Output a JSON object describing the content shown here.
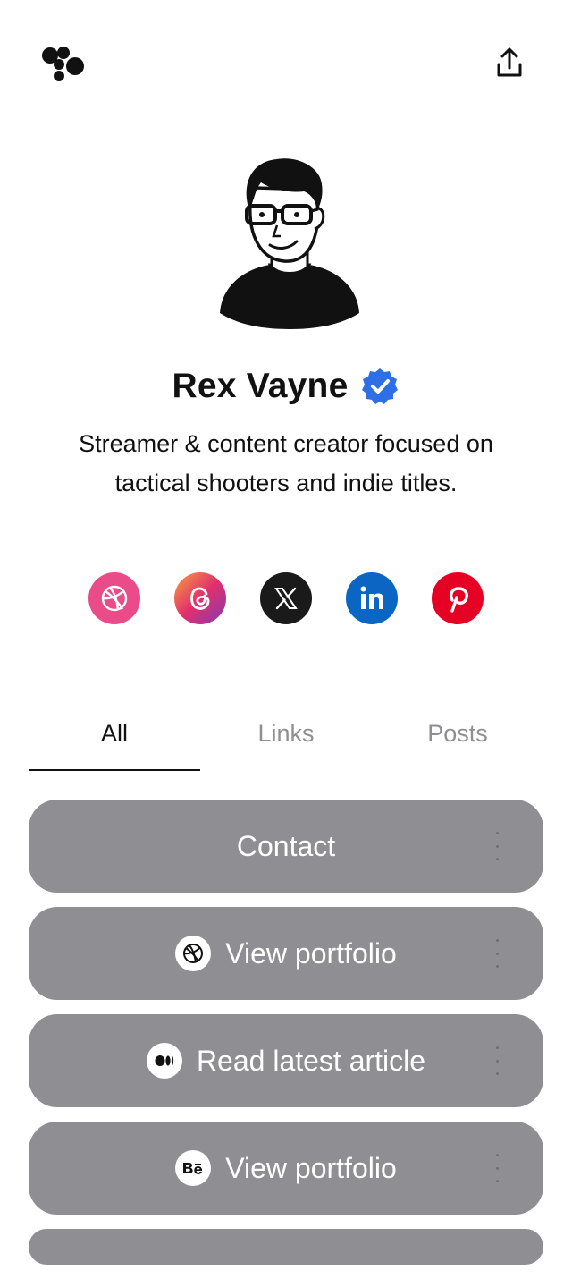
{
  "profile": {
    "name": "Rex Vayne",
    "bio": "Streamer & content creator focused on tactical shooters and indie titles.",
    "verified": true,
    "badge_color": "#2f6fe6"
  },
  "header": {
    "logo_icon": "linktree-blob-logo-icon",
    "share_icon": "share-upload-icon"
  },
  "socials": [
    {
      "name": "Dribbble",
      "icon": "dribbble-icon",
      "color": "#ea4c89"
    },
    {
      "name": "Threads",
      "icon": "threads-icon",
      "color": "#c13584"
    },
    {
      "name": "X",
      "icon": "x-icon",
      "color": "#1a1a1a"
    },
    {
      "name": "LinkedIn",
      "icon": "linkedin-icon",
      "color": "#0a66c2"
    },
    {
      "name": "Pinterest",
      "icon": "pinterest-icon",
      "color": "#e60023"
    }
  ],
  "tabs": [
    {
      "label": "All",
      "active": true
    },
    {
      "label": "Links",
      "active": false
    },
    {
      "label": "Posts",
      "active": false
    }
  ],
  "links": [
    {
      "label": "Contact",
      "icon": null
    },
    {
      "label": "View portfolio",
      "icon": "dribbble-icon"
    },
    {
      "label": "Read latest article",
      "icon": "medium-icon"
    },
    {
      "label": "View portfolio",
      "icon": "behance-icon"
    }
  ],
  "colors": {
    "link_button_bg": "#8e8e93",
    "tab_inactive": "#8f8f93",
    "text": "#111111"
  }
}
